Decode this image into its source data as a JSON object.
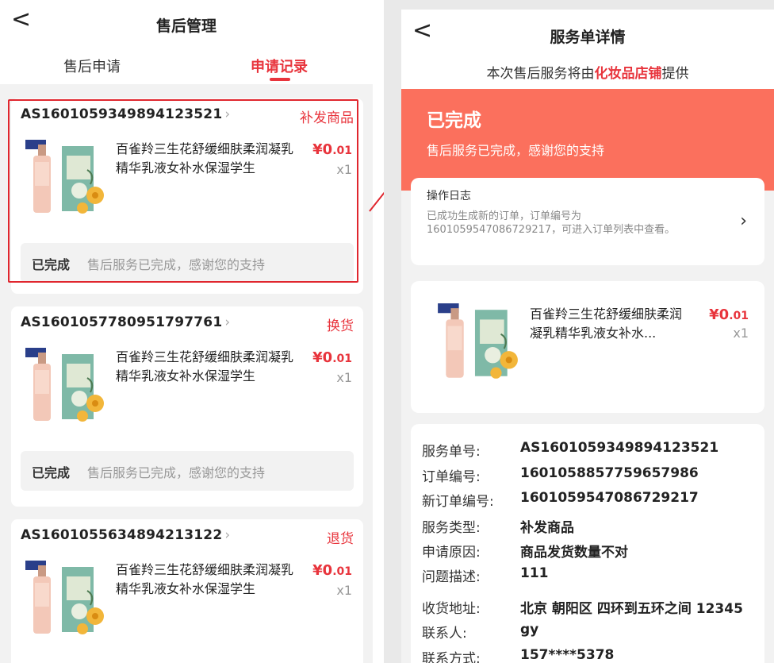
{
  "left": {
    "title": "售后管理",
    "back": "<",
    "tabs": [
      "售后申请",
      "申请记录"
    ],
    "cards": [
      {
        "id": "AS1601059349894123521",
        "type": "补发商品",
        "status": "已完成",
        "desc": "售后服务已完成，感谢您的支持"
      },
      {
        "id": "AS1601057780951797761",
        "type": "换货",
        "status": "已完成",
        "desc": "售后服务已完成，感谢您的支持"
      },
      {
        "id": "AS1601055634894213122",
        "type": "退货",
        "status": "",
        "desc": ""
      }
    ]
  },
  "product": {
    "name": "百雀羚三生花舒缓细肤柔润凝乳精华乳液女补水保湿学生",
    "name_short": "百雀羚三生花舒缓细肤柔润凝乳精华乳液女补水...",
    "price_symbol": "¥",
    "price_int": "0",
    "price_dec": ".01",
    "qty": "x1",
    "brand": "百雀羚"
  },
  "right": {
    "title": "服务单详情",
    "back": "<",
    "provider_pre": "本次售后服务将由",
    "provider_shop": "化妆品店铺",
    "provider_post": "提供",
    "status_big": "已完成",
    "status_small": "售后服务已完成，感谢您的支持",
    "log_title": "操作日志",
    "log_body": "已成功生成新的订单，订单编号为1601059547086729217，可进入订单列表中查看。",
    "info": [
      {
        "k": "服务单号:",
        "v": "AS1601059349894123521"
      },
      {
        "k": "订单编号:",
        "v": "1601058857759657986"
      },
      {
        "k": "新订单编号:",
        "v": "1601059547086729217"
      },
      {
        "k": "服务类型:",
        "v": "补发商品"
      },
      {
        "k": "申请原因:",
        "v": "商品发货数量不对"
      },
      {
        "k": "问题描述:",
        "v": "111"
      },
      {
        "k": "收货地址:",
        "v": "北京 朝阳区 四环到五环之间 12345"
      },
      {
        "k": "联系人:",
        "v": "gy"
      },
      {
        "k": "联系方式:",
        "v": "157****5378"
      }
    ]
  },
  "icons": {
    "back": "chevron-left-icon",
    "chevron": "chevron-right-icon",
    "arrow": "annotation-arrow-icon"
  },
  "colors": {
    "accent": "#e8343c",
    "status_banner": "#fb705d",
    "highlight": "#e0262e"
  }
}
